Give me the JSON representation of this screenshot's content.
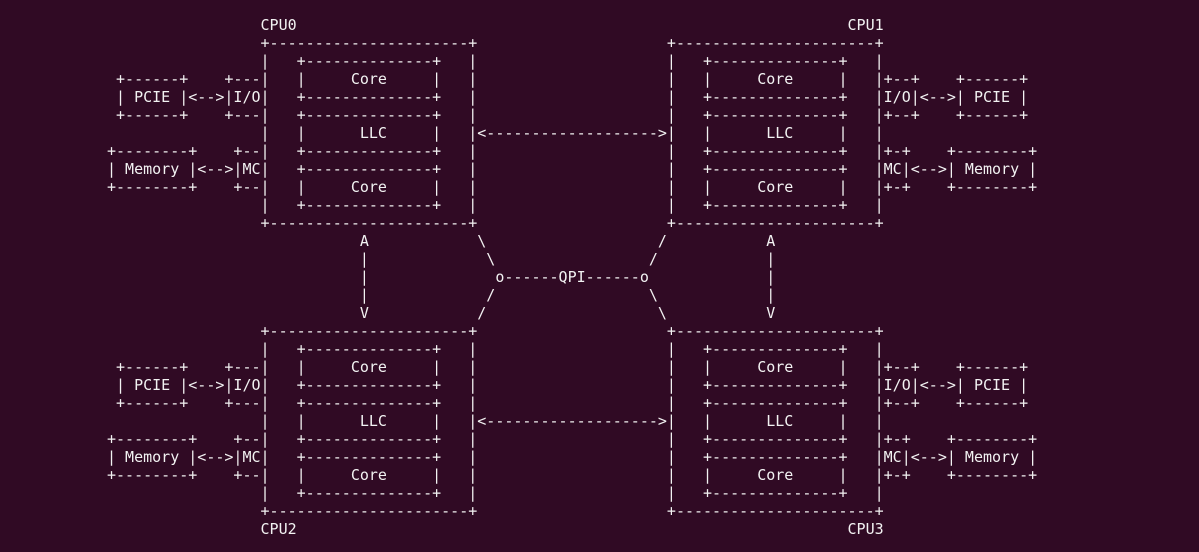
{
  "diagram": {
    "lines": [
      "                 CPU0                                                             CPU1",
      "                 +----------------------+                     +----------------------+",
      "                 |   +--------------+   |                     |   +--------------+   |",
      " +------+    +---|   |     Core     |   |                     |   |     Core     |   |+--+    +------+",
      " | PCIE |<-->|I/O|   +--------------+   |                     |   +--------------+   |I/O|<-->| PCIE |",
      " +------+    +---|   +--------------+   |                     |   +--------------+   |+--+    +------+",
      "                 |   |      LLC     |   |<------------------->|   |      LLC     |   |",
      "+--------+    +--|   +--------------+   |                     |   +--------------+   |+-+    +--------+",
      "| Memory |<-->|MC|   +--------------+   |                     |   +--------------+   |MC|<-->| Memory |",
      "+--------+    +--|   |     Core     |   |                     |   |     Core     |   |+-+    +--------+",
      "                 |   +--------------+   |                     |   +--------------+   |",
      "                 +----------------------+                     +----------------------+",
      "                            A            \\                   /           A",
      "                            |             \\                 /            |",
      "                            |              o------QPI------o             |",
      "                            |             /                 \\            |",
      "                            V            /                   \\           V",
      "                 +----------------------+                     +----------------------+",
      "                 |   +--------------+   |                     |   +--------------+   |",
      " +------+    +---|   |     Core     |   |                     |   |     Core     |   |+--+    +------+",
      " | PCIE |<-->|I/O|   +--------------+   |                     |   +--------------+   |I/O|<-->| PCIE |",
      " +------+    +---|   +--------------+   |                     |   +--------------+   |+--+    +------+",
      "                 |   |      LLC     |   |<------------------->|   |      LLC     |   |",
      "+--------+    +--|   +--------------+   |                     |   +--------------+   |+-+    +--------+",
      "| Memory |<-->|MC|   +--------------+   |                     |   +--------------+   |MC|<-->| Memory |",
      "+--------+    +--|   |     Core     |   |                     |   |     Core     |   |+-+    +--------+",
      "                 |   +--------------+   |                     |   +--------------+   |",
      "                 +----------------------+                     +----------------------+",
      "                 CPU2                                                             CPU3"
    ]
  }
}
